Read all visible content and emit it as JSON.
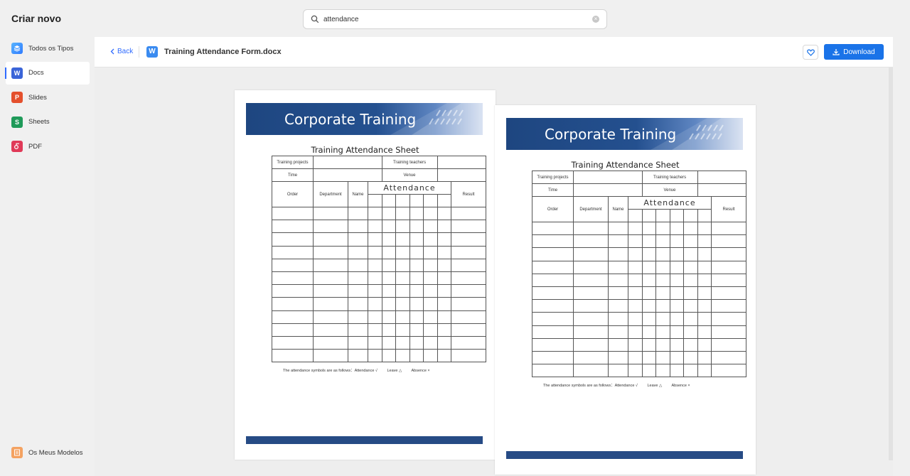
{
  "app": {
    "title": "Criar novo"
  },
  "search": {
    "value": "attendance",
    "clear_icon": "clear-icon"
  },
  "sidebar": {
    "items": [
      {
        "label": "Todos os Tipos",
        "icon": "layers-icon",
        "glyph": ""
      },
      {
        "label": "Docs",
        "icon": "docs-icon",
        "glyph": "W"
      },
      {
        "label": "Slides",
        "icon": "slides-icon",
        "glyph": "P"
      },
      {
        "label": "Sheets",
        "icon": "sheets-icon",
        "glyph": "S"
      },
      {
        "label": "PDF",
        "icon": "pdf-icon",
        "glyph": ""
      }
    ],
    "bottom": {
      "label": "Os Meus Modelos",
      "icon": "my-templates-icon"
    }
  },
  "header": {
    "back_label": "Back",
    "file_name": "Training Attendance Form.docx",
    "file_icon_glyph": "W",
    "download_label": "Download"
  },
  "document": {
    "banner_title": "Corporate Training",
    "sheet_title": "Training Attendance Sheet",
    "labels": {
      "training_projects": "Training projects",
      "training_teachers": "Training teachers",
      "time": "Time",
      "venue": "Venue",
      "order": "Order",
      "department": "Department",
      "name": "Name",
      "attendance": "Attendance",
      "result": "Result"
    },
    "legend": {
      "intro": "The attendance symbols are as follows：Attendance √",
      "leave": "Leave △",
      "absence": "Absence ×"
    }
  },
  "colors": {
    "accent": "#1a73e8",
    "banner": "#264b85",
    "active_indicator": "#2f6bff"
  }
}
